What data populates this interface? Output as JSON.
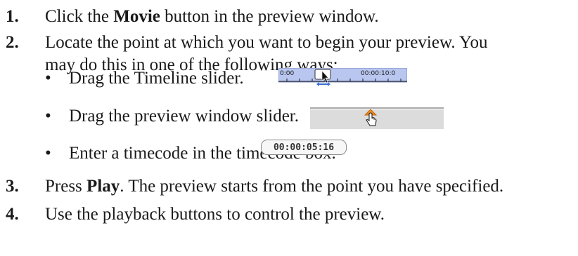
{
  "steps": [
    {
      "num": "1.",
      "before": "Click the ",
      "bold": "Movie",
      "after": " button in the preview window."
    },
    {
      "num": "2.",
      "line1": "Locate the point at which you want to begin your preview. You",
      "line2": "may do this in one of the following ways:"
    },
    {
      "num": "3.",
      "before": "Press ",
      "bold": "Play",
      "after": ". The preview starts from the point you have specified."
    },
    {
      "num": "4.",
      "text": "Use the playback buttons to control the preview."
    }
  ],
  "bullets": {
    "marker": "•",
    "timeline": "Drag the Timeline slider.",
    "preview_slider": "Drag the preview window slider.",
    "timecode": "Enter a timecode in the timecode box."
  },
  "timeline_image": {
    "start_label": "0:00",
    "end_label": "00:00:10:0",
    "icon": "arrow-cursor-icon"
  },
  "preview_slider_image": {
    "icon": "hand-cursor-icon",
    "handle_color": "#f08c1e"
  },
  "timecode_box": {
    "value": "00:00:05:16"
  },
  "colors": {
    "timeline_bg": "#b8c6f0",
    "timeline_arrow": "#3a6fd0"
  }
}
